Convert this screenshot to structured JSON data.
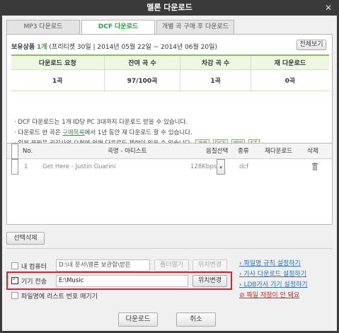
{
  "window": {
    "title": "멜론 다운로드",
    "close_label": "✕"
  },
  "tabs": [
    {
      "label": "MP3 다운로드",
      "active": false
    },
    {
      "label": "DCF 다운로드",
      "active": true
    },
    {
      "label": "개별 곡 구매 후 다운로드",
      "active": false
    }
  ],
  "owned": {
    "label": "보유상품",
    "count": "1개",
    "detail": "(프리티켓 30일 | 2014년 05월 22일 ~ 2014년 06월 20일)",
    "view_all_label": "전체보기"
  },
  "stats": {
    "headers": [
      "다운로드 요청",
      "잔여 곡 수",
      "차감 곡 수",
      "재 다운로드"
    ],
    "values": [
      "1곡",
      "97/100곡",
      "1곡",
      "0곡"
    ]
  },
  "notes": {
    "line1": "DCF 다운로드는 1개 ID당 PC 3대까지 다운로드 받을 수 있습니다.",
    "line2_pre": "다운로드 한 곡은 ",
    "line2_link": "구매목록",
    "line2_post": "에서 1년 동안 재 다운로드 할 수 있습니다.",
    "line3": "일부 음원은 권리사의 요청에 의해 다운로드 제한이 있을 수 있습니다.",
    "tags": [
      "개별",
      "DCF",
      "앨범",
      "ST"
    ]
  },
  "list": {
    "headers": {
      "no": "No.",
      "title": "곡명 - 아티스트",
      "quality": "음질선택",
      "type": "종류",
      "redownload": "재다운로드",
      "delete": "삭제"
    },
    "rows": [
      {
        "no": "1",
        "title": "Get Here - Justin Guarini",
        "quality": "128Kbps",
        "type": "dcf",
        "redownload": ""
      }
    ]
  },
  "delete_selected_label": "선택삭제",
  "save": {
    "my_computer_label": "내 컴퓨터",
    "my_computer_path": "D:\\내 문서\\멜론 보관함\\받은",
    "open_folder_label": "폴더열기",
    "change_location_label": "위치변경",
    "device_label": "기기 전송",
    "device_path": "E:\\Music",
    "device_change_label": "위치변경",
    "filename_option_label": "파일명에 리스트 번호 매기기"
  },
  "side_links": [
    "파일명 규칙 설정하기",
    "가사 다운로드 설정하기",
    "LDB가사 기기 설정하기",
    "파일 저장이 안 돼요"
  ],
  "footer": {
    "download_label": "다운로드",
    "cancel_label": "취소"
  }
}
